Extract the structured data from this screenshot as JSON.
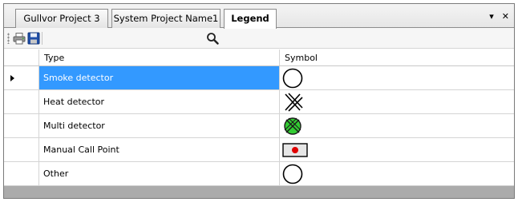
{
  "tabs": [
    {
      "label": "Gullvor Project 3"
    },
    {
      "label": "System Project Name1"
    },
    {
      "label": "Legend"
    }
  ],
  "tabstrip_controls": {
    "dropdown": "▾",
    "close": "✕"
  },
  "toolbar": {
    "print_icon": "printer-icon",
    "save_icon": "floppy-disk-icon",
    "search_icon": "magnifier-icon"
  },
  "grid": {
    "columns": [
      "Type",
      "Symbol"
    ],
    "rows": [
      {
        "type": "Smoke detector",
        "symbol": "circle-outline",
        "selected": true
      },
      {
        "type": "Heat detector",
        "symbol": "double-cross"
      },
      {
        "type": "Multi detector",
        "symbol": "green-crossed-circle"
      },
      {
        "type": "Manual Call Point",
        "symbol": "box-red-dot"
      },
      {
        "type": "Other",
        "symbol": "circle-outline"
      }
    ]
  },
  "colors": {
    "selection": "#3399ff",
    "multi_detector_fill": "#33cc33",
    "call_point_dot": "#e00000"
  }
}
